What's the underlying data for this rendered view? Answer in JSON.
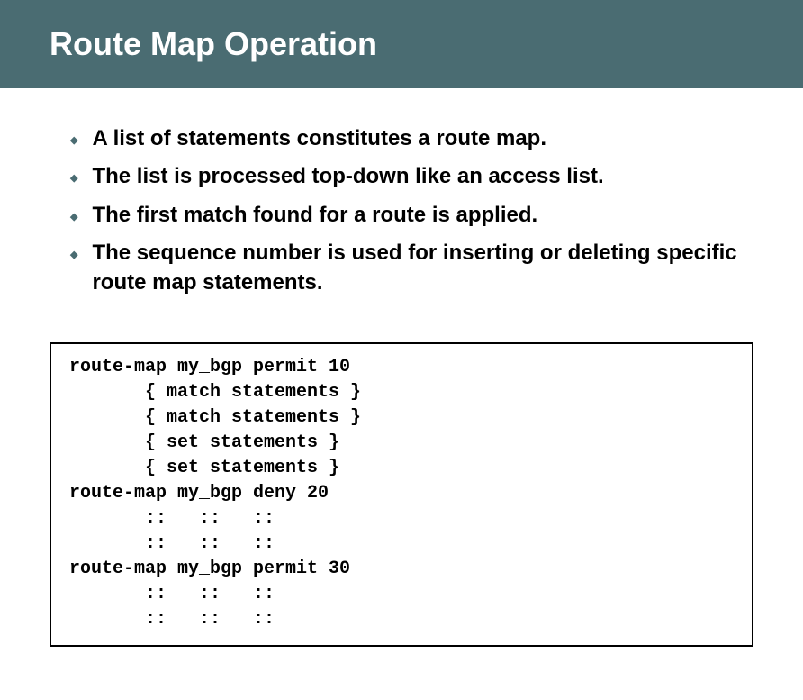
{
  "header": {
    "title": "Route Map Operation"
  },
  "bullets": [
    "A list of statements constitutes a route map.",
    "The list is processed top-down like an access list.",
    "The first match found for a route is applied.",
    "The sequence number is used for inserting or deleting specific route map statements."
  ],
  "code": {
    "line1": "route-map my_bgp permit 10",
    "line2": "       { match statements }",
    "line3": "       { match statements }",
    "line4": "       { set statements }",
    "line5": "       { set statements }",
    "line6": "route-map my_bgp deny 20",
    "line7": "       ::   ::   ::",
    "line8": "       ::   ::   ::",
    "line9": "route-map my_bgp permit 30",
    "line10": "       ::   ::   ::",
    "line11": "       ::   ::   ::"
  }
}
